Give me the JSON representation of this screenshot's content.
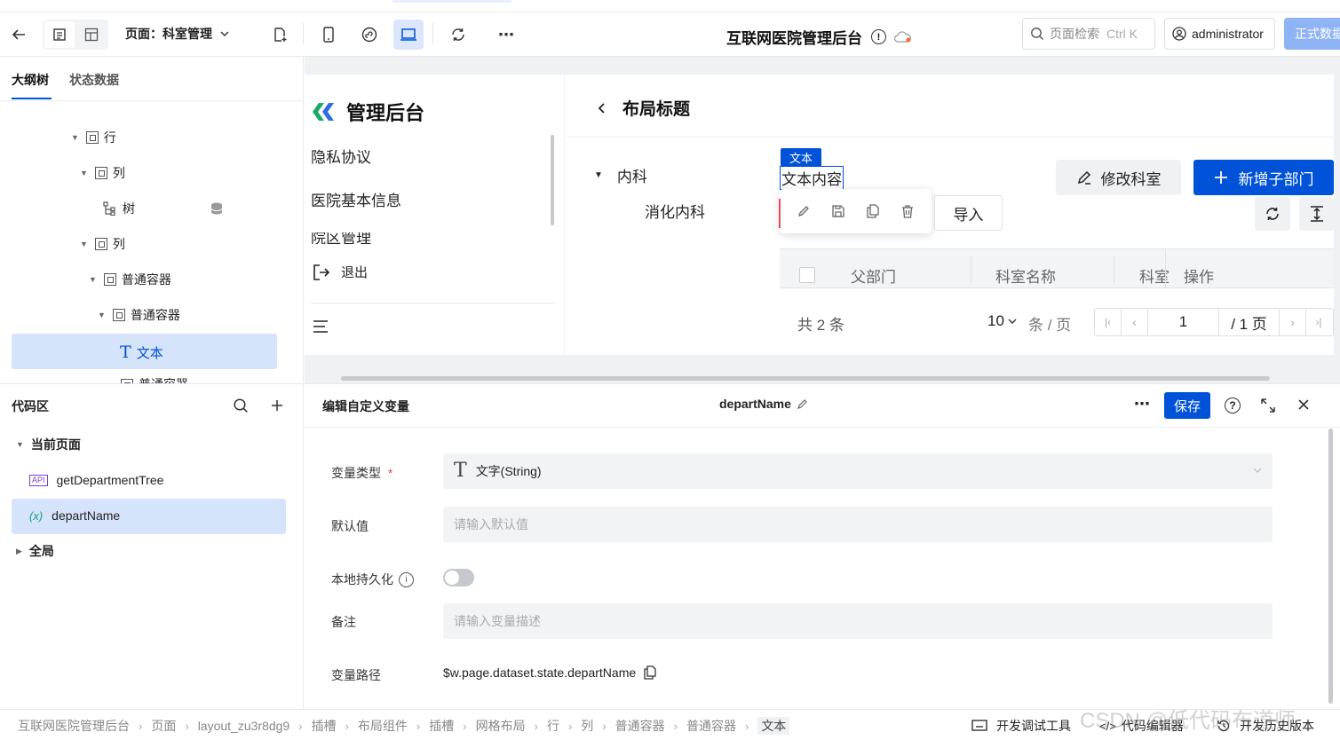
{
  "topbar": {
    "page_selector": "页面：科室管理",
    "app_title": "互联网医院管理后台",
    "search_label": "页面检索",
    "search_shortcut": "Ctrl K",
    "user": "administrator",
    "publish": "正式数据"
  },
  "left": {
    "tabs": [
      "大纲树",
      "状态数据"
    ],
    "tree": [
      {
        "label": "行"
      },
      {
        "label": "列"
      },
      {
        "label": "树"
      },
      {
        "label": "列"
      },
      {
        "label": "普通容器"
      },
      {
        "label": "普通容器"
      },
      {
        "label": "文本"
      },
      {
        "label": "普通容器"
      }
    ],
    "code_title": "代码区",
    "current_page": "当前页面",
    "api_badge": "API",
    "api_item": "getDepartmentTree",
    "var_badge": "(x)",
    "var_item": "departName",
    "global": "全局"
  },
  "preview": {
    "brand": "管理后台",
    "menu": [
      "隐私协议",
      "医院基本信息",
      "院区管理"
    ],
    "logout": "退出",
    "header": "布局标题",
    "tree_nodes": [
      "内科",
      "消化内科"
    ],
    "text_tag": "文本",
    "text_content": "文本内容",
    "edit_btn": "修改科室",
    "add_btn": "新增子部门",
    "import_btn": "导入",
    "columns": [
      "父部门",
      "科室名称",
      "科室",
      "操作"
    ],
    "total": "共 2 条",
    "page_size": "10",
    "per_page": "条 / 页",
    "page_num": "1",
    "page_total": "/ 1 页"
  },
  "editor": {
    "title": "编辑自定义变量",
    "var_name": "departName",
    "save": "保存",
    "fields": {
      "type_label": "变量类型",
      "type_required": "*",
      "type_value": "文字(String)",
      "default_label": "默认值",
      "default_placeholder": "请输入默认值",
      "persist_label": "本地持久化",
      "remark_label": "备注",
      "remark_placeholder": "请输入变量描述",
      "path_label": "变量路径",
      "path_value": "$w.page.dataset.state.departName"
    }
  },
  "statusbar": {
    "breadcrumbs": [
      "互联网医院管理后台",
      "页面",
      "layout_zu3r8dg9",
      "插槽",
      "布局组件",
      "插槽",
      "网格布局",
      "行",
      "列",
      "普通容器",
      "普通容器",
      "文本"
    ],
    "debug": "开发调试工具",
    "code_editor": "代码编辑器",
    "history": "开发历史版本",
    "watermark": "CSDN @低代码布道师"
  },
  "colors": {
    "primary": "#0052d9",
    "selected_bg": "#d6e4fb"
  }
}
